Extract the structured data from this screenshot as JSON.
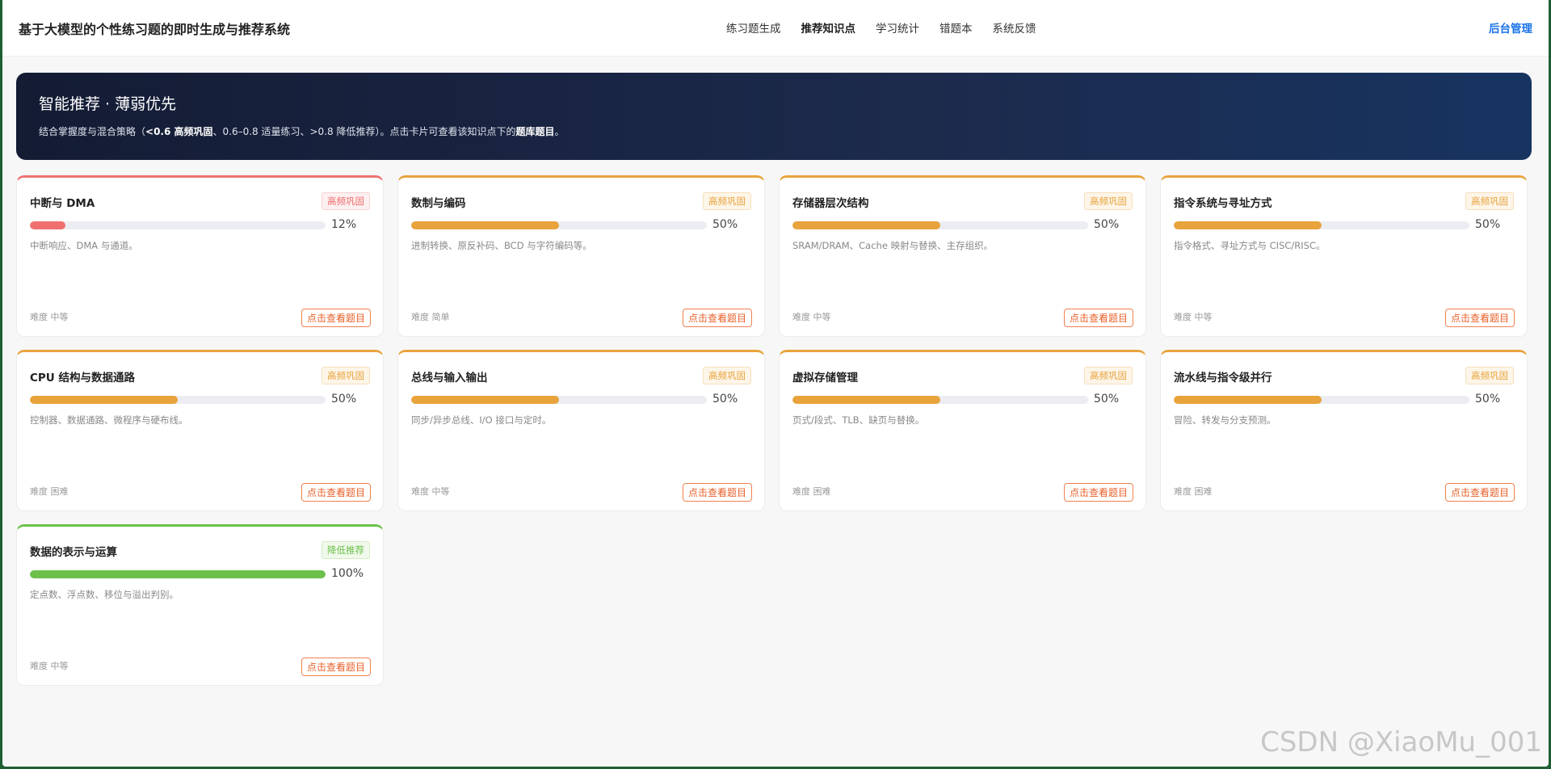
{
  "header": {
    "title": "基于大模型的个性练习题的即时生成与推荐系统",
    "nav": [
      {
        "label": "练习题生成",
        "active": false
      },
      {
        "label": "推荐知识点",
        "active": true
      },
      {
        "label": "学习统计",
        "active": false
      },
      {
        "label": "错题本",
        "active": false
      },
      {
        "label": "系统反馈",
        "active": false
      }
    ],
    "admin_label": "后台管理"
  },
  "hero": {
    "title": "智能推荐 · 薄弱优先",
    "sub_pre": "结合掌握度与混合策略（",
    "sub_strong1": "<0.6 高频巩固",
    "sub_mid": "、0.6–0.8 适量练习、>0.8 降低推荐）。点击卡片可查看该知识点下的",
    "sub_strong2": "题库题目",
    "sub_end": "。"
  },
  "cards": [
    {
      "title": "中断与 DMA",
      "badge": "高频巩固",
      "mastery": 0.12,
      "percent_text": "12%",
      "desc": "中断响应、DMA 与通道。",
      "difficulty": "难度 中等",
      "button": "点击查看题目",
      "color": "#f07070"
    },
    {
      "title": "数制与编码",
      "badge": "高频巩固",
      "mastery": 0.5,
      "percent_text": "50%",
      "desc": "进制转换、原反补码、BCD 与字符编码等。",
      "difficulty": "难度 简单",
      "button": "点击查看题目",
      "color": "#e8a33c"
    },
    {
      "title": "存储器层次结构",
      "badge": "高频巩固",
      "mastery": 0.5,
      "percent_text": "50%",
      "desc": "SRAM/DRAM、Cache 映射与替换、主存组织。",
      "difficulty": "难度 中等",
      "button": "点击查看题目",
      "color": "#e8a33c"
    },
    {
      "title": "指令系统与寻址方式",
      "badge": "高频巩固",
      "mastery": 0.5,
      "percent_text": "50%",
      "desc": "指令格式、寻址方式与 CISC/RISC。",
      "difficulty": "难度 中等",
      "button": "点击查看题目",
      "color": "#e8a33c"
    },
    {
      "title": "CPU 结构与数据通路",
      "badge": "高频巩固",
      "mastery": 0.5,
      "percent_text": "50%",
      "desc": "控制器、数据通路、微程序与硬布线。",
      "difficulty": "难度 困难",
      "button": "点击查看题目",
      "color": "#e8a33c"
    },
    {
      "title": "总线与输入输出",
      "badge": "高频巩固",
      "mastery": 0.5,
      "percent_text": "50%",
      "desc": "同步/异步总线、I/O 接口与定时。",
      "difficulty": "难度 中等",
      "button": "点击查看题目",
      "color": "#e8a33c"
    },
    {
      "title": "虚拟存储管理",
      "badge": "高频巩固",
      "mastery": 0.5,
      "percent_text": "50%",
      "desc": "页式/段式、TLB、缺页与替换。",
      "difficulty": "难度 困难",
      "button": "点击查看题目",
      "color": "#e8a33c"
    },
    {
      "title": "流水线与指令级并行",
      "badge": "高频巩固",
      "mastery": 0.5,
      "percent_text": "50%",
      "desc": "冒险、转发与分支预测。",
      "difficulty": "难度 困难",
      "button": "点击查看题目",
      "color": "#e8a33c"
    },
    {
      "title": "数据的表示与运算",
      "badge": "降低推荐",
      "mastery": 1.0,
      "percent_text": "100%",
      "desc": "定点数、浮点数、移位与溢出判别。",
      "difficulty": "难度 中等",
      "button": "点击查看题目",
      "color": "#6cc04a"
    }
  ],
  "watermark": "CSDN @XiaoMu_001"
}
